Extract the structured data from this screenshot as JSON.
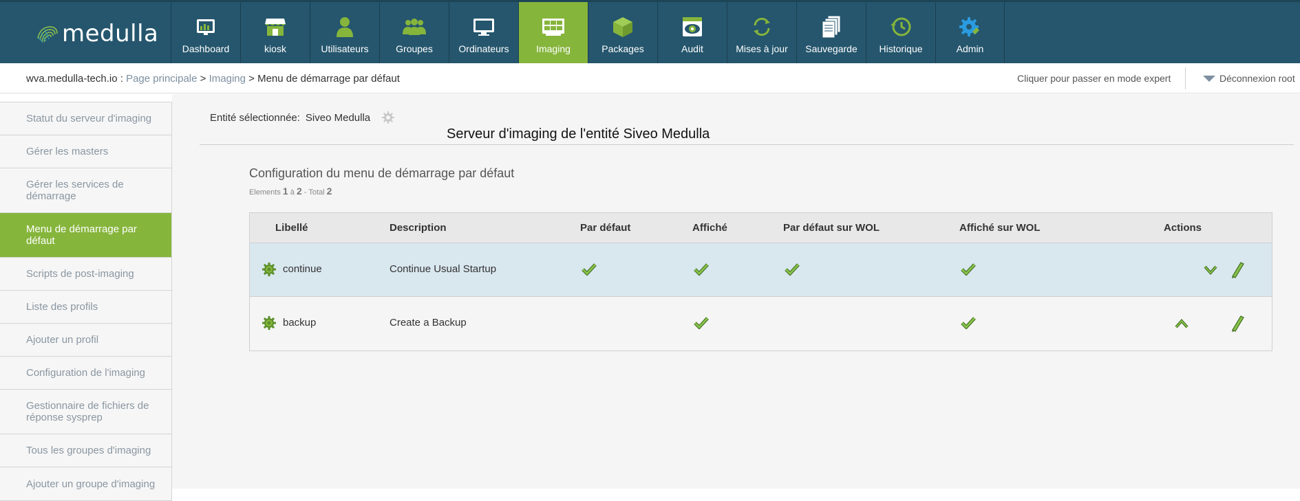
{
  "app": {
    "logo_text": "medulla",
    "brand_color": "#25566d",
    "accent_color": "#86b53c"
  },
  "nav": [
    {
      "label": "Dashboard",
      "icon": "dashboard-icon"
    },
    {
      "label": "kiosk",
      "icon": "kiosk-icon"
    },
    {
      "label": "Utilisateurs",
      "icon": "user-icon"
    },
    {
      "label": "Groupes",
      "icon": "group-icon"
    },
    {
      "label": "Ordinateurs",
      "icon": "monitor-icon"
    },
    {
      "label": "Imaging",
      "icon": "imaging-icon",
      "active": true
    },
    {
      "label": "Packages",
      "icon": "package-icon"
    },
    {
      "label": "Audit",
      "icon": "audit-icon"
    },
    {
      "label": "Mises à jour",
      "icon": "update-icon"
    },
    {
      "label": "Sauvegarde",
      "icon": "backup-icon"
    },
    {
      "label": "Historique",
      "icon": "history-icon"
    },
    {
      "label": "Admin",
      "icon": "admin-gear-icon"
    }
  ],
  "breadcrumb": {
    "host": "wva.medulla-tech.io",
    "sep1": " : ",
    "home": "Page principale",
    "gt": " > ",
    "section": "Imaging",
    "current": "Menu de démarrage par défaut"
  },
  "header_right": {
    "expert": "Cliquer pour passer en mode expert",
    "logout": "Déconnexion root"
  },
  "sidebar": [
    {
      "label": "Statut du serveur d'imaging"
    },
    {
      "label": "Gérer les masters"
    },
    {
      "label": "Gérer les services de démarrage"
    },
    {
      "label": "Menu de démarrage par défaut",
      "active": true
    },
    {
      "label": "Scripts de post-imaging"
    },
    {
      "label": "Liste des profils"
    },
    {
      "label": "Ajouter un profil"
    },
    {
      "label": "Configuration de l'imaging"
    },
    {
      "label": "Gestionnaire de fichiers de réponse sysprep"
    },
    {
      "label": "Tous les groupes d'imaging"
    },
    {
      "label": "Ajouter un groupe d'imaging"
    }
  ],
  "entity": {
    "label": "Entité sélectionnée:",
    "value": "Siveo Medulla"
  },
  "server_title": "Serveur d'imaging de l'entité Siveo Medulla",
  "section_title": "Configuration du menu de démarrage par défaut",
  "pagination": {
    "elements_label": "Elements",
    "from": "1",
    "a": "à",
    "to": "2",
    "total_label": "- Total",
    "total": "2"
  },
  "table": {
    "headers": [
      "Libellé",
      "Description",
      "Par défaut",
      "Affiché",
      "Par défaut sur WOL",
      "Affiché sur WOL",
      "Actions"
    ],
    "rows": [
      {
        "label": "continue",
        "description": "Continue Usual Startup",
        "par_defaut": true,
        "affiche": true,
        "par_defaut_wol": true,
        "affiche_wol": true,
        "actions": [
          "move-down-icon",
          "edit-icon"
        ]
      },
      {
        "label": "backup",
        "description": "Create a Backup",
        "par_defaut": false,
        "affiche": true,
        "par_defaut_wol": false,
        "affiche_wol": true,
        "actions": [
          "move-up-icon",
          "edit-icon"
        ]
      }
    ]
  }
}
